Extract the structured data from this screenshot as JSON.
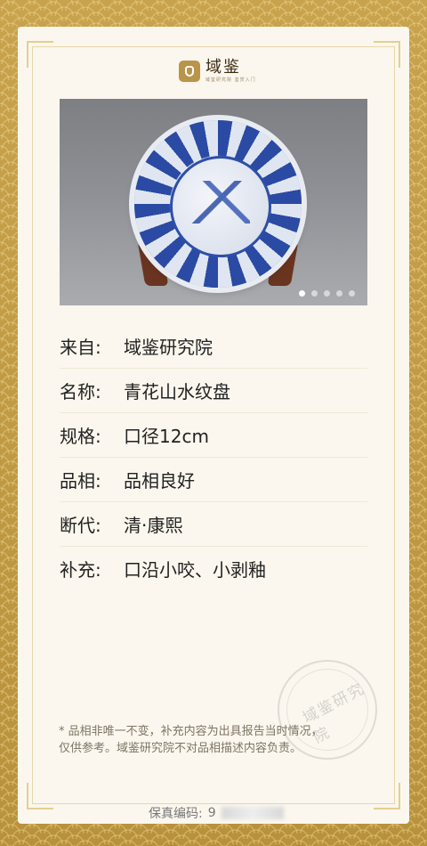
{
  "brand": {
    "title": "域鉴",
    "subtitle": "域鉴研究院 鉴赏入门"
  },
  "carousel": {
    "dots": 5,
    "active_index": 0
  },
  "info": [
    {
      "label": "来自:",
      "value": "域鉴研究院"
    },
    {
      "label": "名称:",
      "value": "青花山水纹盘"
    },
    {
      "label": "规格:",
      "value": "口径12cm"
    },
    {
      "label": "品相:",
      "value": "品相良好"
    },
    {
      "label": "断代:",
      "value": "清·康熙"
    },
    {
      "label": "补充:",
      "value": "口沿小咬、小剥釉"
    }
  ],
  "note": "* 品相非唯一不变，补充内容为出具报告当时情况，\n  仅供参考。域鉴研究院不对品相描述内容负责。",
  "stamp": {
    "text": "域鉴研究院"
  },
  "code": {
    "label": "保真编码:",
    "value_visible": "9"
  },
  "colors": {
    "frame": "#c29a44",
    "card": "#fbf7ee",
    "accent": "#b99449"
  }
}
